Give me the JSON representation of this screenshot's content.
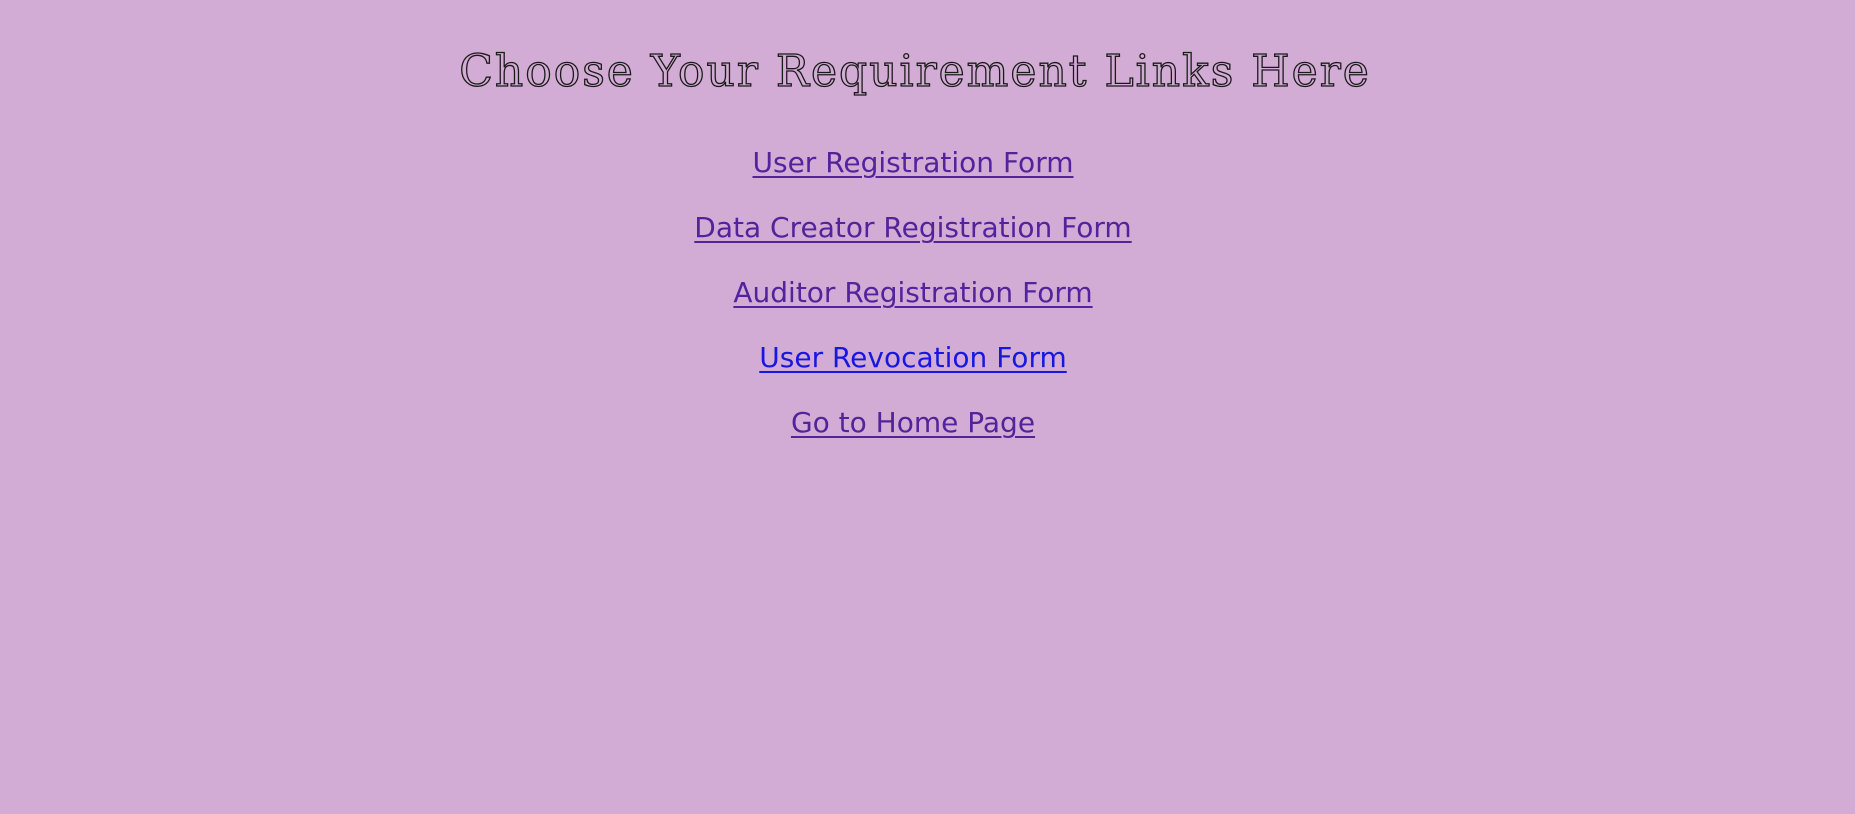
{
  "page": {
    "title": "Choose Your Requirement Links Here"
  },
  "links": [
    {
      "label": "User Registration Form",
      "state": "visited"
    },
    {
      "label": "Data Creator Registration Form",
      "state": "visited"
    },
    {
      "label": "Auditor Registration Form",
      "state": "visited"
    },
    {
      "label": "User Revocation Form",
      "state": "unvisited"
    },
    {
      "label": "Go to Home Page",
      "state": "visited"
    }
  ],
  "colors": {
    "background": "#d2acd4",
    "title_outline": "#1a1a1a",
    "link_visited": "#52239a",
    "link_unvisited": "#1717e0"
  }
}
